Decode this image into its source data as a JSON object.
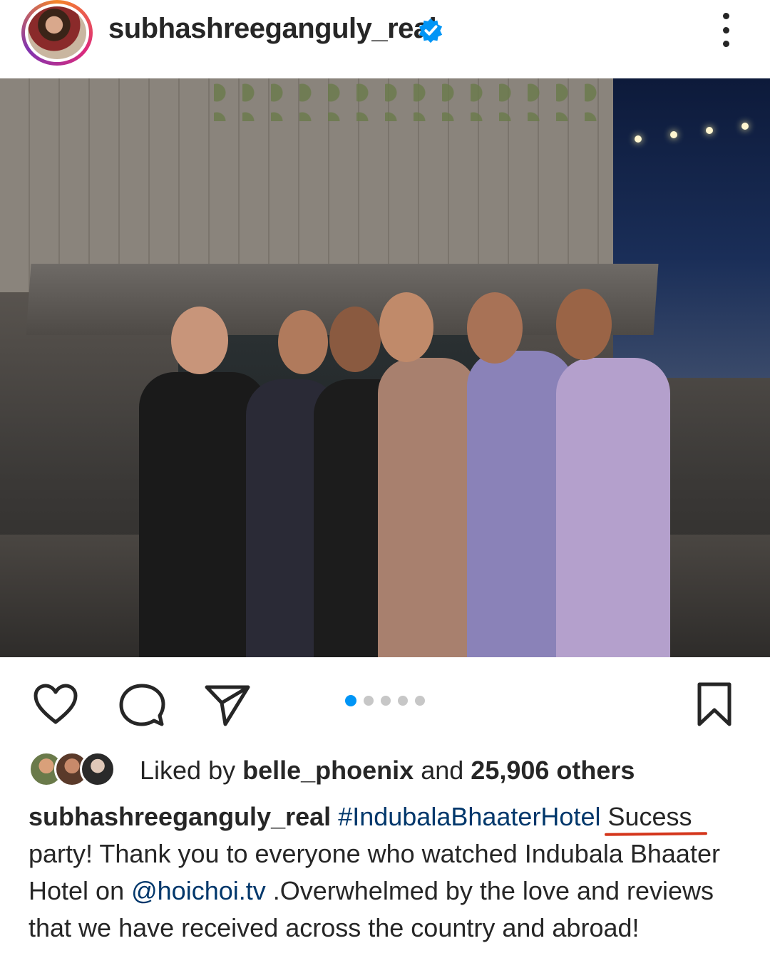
{
  "post_header": {
    "username": "subhashreeganguly_real",
    "verified": true,
    "verified_icon": "verified-badge-icon",
    "more_icon": "more-vertical-icon"
  },
  "post_image": {
    "description_icon": "post-photo"
  },
  "actions": {
    "like_icon": "heart-icon",
    "comment_icon": "comment-icon",
    "share_icon": "send-icon",
    "save_icon": "bookmark-icon",
    "carousel_total": 5,
    "carousel_active_index": 0
  },
  "likes": {
    "prefix": "Liked by",
    "first_liker": "belle_phoenix",
    "connector": "and",
    "others": "25,906 others"
  },
  "caption": {
    "username": "subhashreeganguly_real",
    "hashtag": "#IndubalaBhaaterHotel",
    "annotated_word": "Sucess",
    "text_part1": "party! Thank you to everyone who watched Indubala Bhaater Hotel on",
    "mention": "@hoichoi.tv",
    "text_part2": ".Overwhelmed by the love and reviews that we have received across the country and abroad!"
  },
  "colors": {
    "accent_blue": "#0095f6",
    "link_blue": "#00376b",
    "annotation_red": "#d4361c",
    "text": "#262626"
  }
}
